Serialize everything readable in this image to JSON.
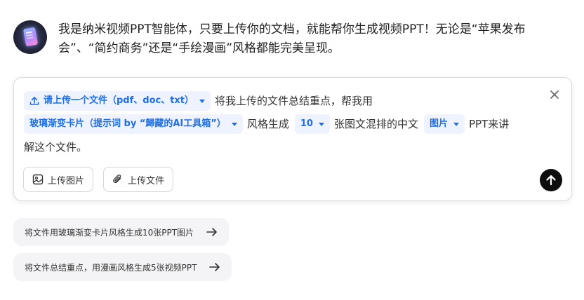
{
  "agent": {
    "avatar_icon": "ppt-card-icon",
    "intro_line1": "我是纳米视频PPT智能体，只要上传你的文档，就能帮你生成视频PPT！无论是“苹果发布",
    "intro_line2": "会”、“简约商务”还是“手绘漫画”风格都能完美呈现。"
  },
  "composer": {
    "upload_chip_label": "请上传一个文件（pdf、doc、txt）",
    "text1": "将我上传的文件总结重点，帮我用",
    "style_chip_label": "玻璃渐变卡片（提示词 by “歸藏的AI工具箱”）",
    "text2": "风格生成",
    "count_chip_label": "10",
    "text3": "张图文混排的中文",
    "format_chip_label": "图片",
    "text4": "PPT来讲",
    "text5": "解这个文件。",
    "upload_image_label": "上传图片",
    "upload_file_label": "上传文件",
    "accent_color": "#1f6fe5"
  },
  "suggestions": [
    {
      "label": "将文件用玻璃渐变卡片风格生成10张PPT图片"
    },
    {
      "label": "将文件总结重点，用漫画风格生成5张视频PPT"
    }
  ]
}
